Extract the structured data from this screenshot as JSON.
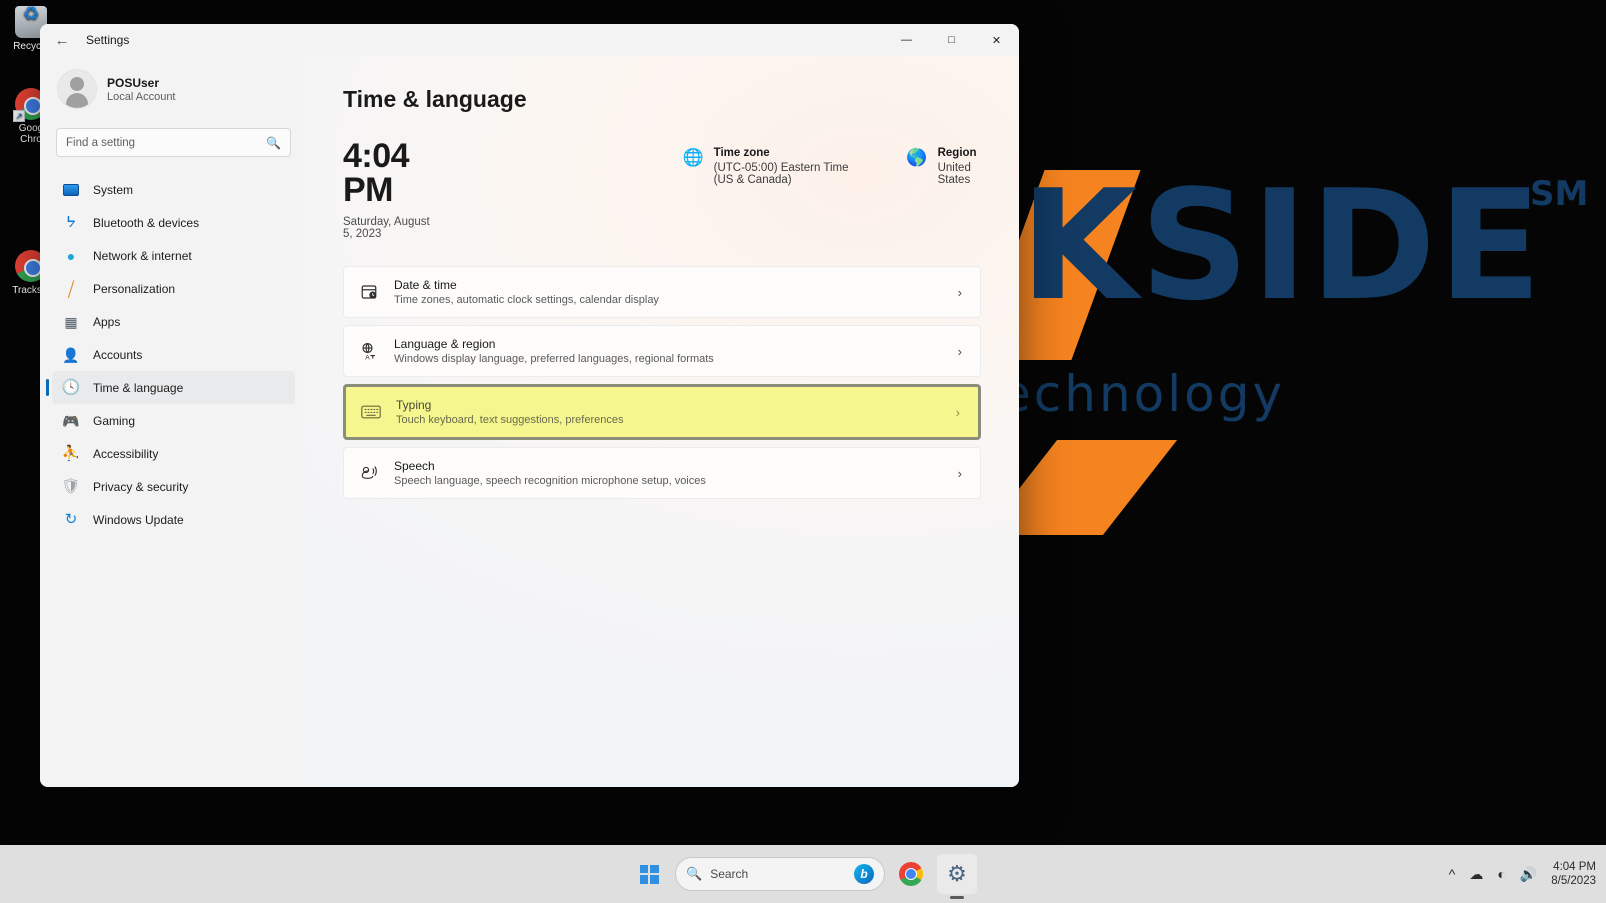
{
  "desktop": {
    "icons": [
      {
        "name": "Recycle Bin",
        "label": "Recycle",
        "icon": "recycle-bin-icon"
      },
      {
        "name": "Google Chrome",
        "label": "Goog\nChro",
        "icon": "chrome-icon"
      },
      {
        "name": "Trackside",
        "label": "Tracksid",
        "icon": "chrome-icon"
      }
    ],
    "wallpaper": {
      "word": "KSIDE",
      "trademark": "SM",
      "subtitle": "echnology",
      "navy": "#123a63",
      "orange": "#f5831f",
      "background": "#050505"
    }
  },
  "window": {
    "title": "Settings",
    "back_icon": "back-arrow-icon",
    "controls": {
      "minimize": "—",
      "maximize": "□",
      "close": "✕"
    }
  },
  "sidebar": {
    "account": {
      "name": "POSUser",
      "type": "Local Account",
      "avatar_icon": "user-avatar-icon"
    },
    "search": {
      "placeholder": "Find a setting",
      "value": "",
      "icon": "search-icon"
    },
    "items": [
      {
        "label": "System",
        "icon": "monitor-icon",
        "selected": false
      },
      {
        "label": "Bluetooth & devices",
        "icon": "bluetooth-icon",
        "selected": false
      },
      {
        "label": "Network & internet",
        "icon": "wifi-icon",
        "selected": false
      },
      {
        "label": "Personalization",
        "icon": "paintbrush-icon",
        "selected": false
      },
      {
        "label": "Apps",
        "icon": "apps-icon",
        "selected": false
      },
      {
        "label": "Accounts",
        "icon": "accounts-icon",
        "selected": false
      },
      {
        "label": "Time & language",
        "icon": "clock-icon",
        "selected": true
      },
      {
        "label": "Gaming",
        "icon": "gamepad-icon",
        "selected": false
      },
      {
        "label": "Accessibility",
        "icon": "accessibility-icon",
        "selected": false
      },
      {
        "label": "Privacy & security",
        "icon": "shield-icon",
        "selected": false
      },
      {
        "label": "Windows Update",
        "icon": "update-icon",
        "selected": false
      }
    ]
  },
  "main": {
    "page_title": "Time & language",
    "clock": {
      "time": "4:04 PM",
      "date": "Saturday, August 5, 2023"
    },
    "timezone": {
      "label": "Time zone",
      "value": "(UTC-05:00) Eastern Time (US & Canada)",
      "icon": "timezone-globe-icon"
    },
    "region": {
      "label": "Region",
      "value": "United States",
      "icon": "globe-icon"
    },
    "cards": [
      {
        "title": "Date & time",
        "desc": "Time zones, automatic clock settings, calendar display",
        "icon": "calendar-clock-icon",
        "highlighted": false
      },
      {
        "title": "Language & region",
        "desc": "Windows display language, preferred languages, regional formats",
        "icon": "globe-translate-icon",
        "highlighted": false
      },
      {
        "title": "Typing",
        "desc": "Touch keyboard, text suggestions, preferences",
        "icon": "keyboard-icon",
        "highlighted": true
      },
      {
        "title": "Speech",
        "desc": "Speech language, speech recognition microphone setup, voices",
        "icon": "speech-icon",
        "highlighted": false
      }
    ],
    "chevron": "›",
    "highlight_color": "#f6f68e",
    "highlight_border": "#8c8c7c"
  },
  "taskbar": {
    "start_label": "Start",
    "search": {
      "placeholder": "Search",
      "icon": "search-icon",
      "bing_badge": "b"
    },
    "apps": [
      {
        "label": "Google Chrome",
        "icon": "chrome-icon",
        "active": false
      },
      {
        "label": "Settings",
        "icon": "gear-icon",
        "active": true
      }
    ],
    "tray": {
      "icons": [
        {
          "name": "chevron-up-icon",
          "glyph": "⌃"
        },
        {
          "name": "network-disconnected-icon",
          "glyph": "☁"
        },
        {
          "name": "wifi-icon",
          "glyph": "◠"
        },
        {
          "name": "volume-icon",
          "glyph": "🔈"
        }
      ],
      "time": "4:04 PM",
      "date": "8/5/2023"
    }
  }
}
